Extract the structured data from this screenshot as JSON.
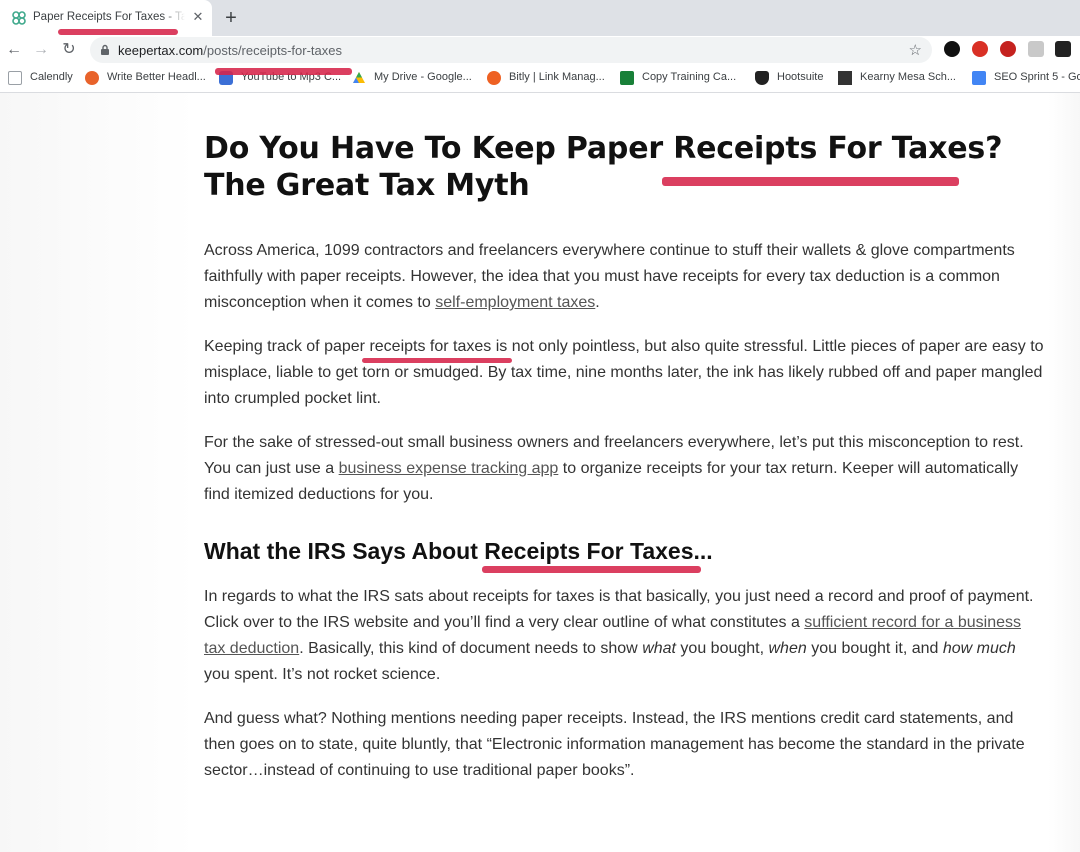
{
  "browser": {
    "tab": {
      "title": "Paper Receipts For Taxes - Tax"
    },
    "url_host": "keepertax.com",
    "url_path": "/posts/receipts-for-taxes",
    "bookmarks": [
      {
        "label": "Calendly",
        "icon": "calendar-icon",
        "color": "#9aa0a6"
      },
      {
        "label": "Write Better Headl...",
        "icon": "check-circle-icon",
        "color": "#e8632b"
      },
      {
        "label": "YouTube to Mp3 C...",
        "icon": "download-icon",
        "color": "#3b6fd6"
      },
      {
        "label": "My Drive - Google...",
        "icon": "google-drive-icon",
        "color": "#34a853"
      },
      {
        "label": "Bitly | Link Manag...",
        "icon": "bitly-icon",
        "color": "#ee6123"
      },
      {
        "label": "Copy Training Ca...",
        "icon": "plus-square-icon",
        "color": "#188038"
      },
      {
        "label": "Hootsuite",
        "icon": "owl-icon",
        "color": "#222222"
      },
      {
        "label": "Kearny Mesa Sch...",
        "icon": "ibc-icon",
        "color": "#333333"
      },
      {
        "label": "SEO Sprint 5 - Go",
        "icon": "google-docs-icon",
        "color": "#4285f4"
      }
    ]
  },
  "article": {
    "title_line1": "Do You Have To Keep Paper Receipts For Taxes?",
    "title_line2": "The Great Tax Myth",
    "p1": {
      "text": "Across America, 1099 contractors and freelancers everywhere continue to stuff their wallets & glove compartments faithfully with paper receipts. However, the idea that you must have receipts for every tax deduction is a common misconception when it comes to ",
      "link": "self-employment taxes",
      "tail": "."
    },
    "p2": "Keeping track of paper receipts for taxes is not only pointless, but also quite stressful. Little pieces of paper are easy to misplace, liable to get torn or smudged. By tax time, nine months later, the ink has likely rubbed off and paper mangled into crumpled pocket lint.",
    "p3": {
      "text": "For the sake of stressed-out small business owners and freelancers everywhere, let’s put this misconception to rest. You can just use a ",
      "link": "business expense tracking app",
      "tail": " to organize receipts for your tax return. Keeper will automatically find itemized deductions for you."
    },
    "h2": "What the IRS Says About Receipts For Taxes...",
    "p4": {
      "text": "In regards to what the IRS sats about receipts for taxes is that basically, you just need a record and proof of payment. Click over to the IRS website and you’ll find a very clear outline of what constitutes a ",
      "link": "sufficient record for a business tax deduction",
      "mid": ". Basically, this kind of document  needs to show ",
      "em1": "what",
      "mid2": " you bought, ",
      "em2": "when",
      "mid3": " you bought it, and ",
      "em3": "how much",
      "tail": " you spent. It’s not rocket science."
    },
    "p5": "And guess what? Nothing mentions needing paper receipts. Instead, the IRS mentions credit card statements, and then goes on to state, quite bluntly, that “Electronic information management has become the standard in the private sector…instead of continuing to use traditional paper books”."
  },
  "colors": {
    "highlight": "#d6244a",
    "body_text": "#333333",
    "heading": "#111111"
  }
}
